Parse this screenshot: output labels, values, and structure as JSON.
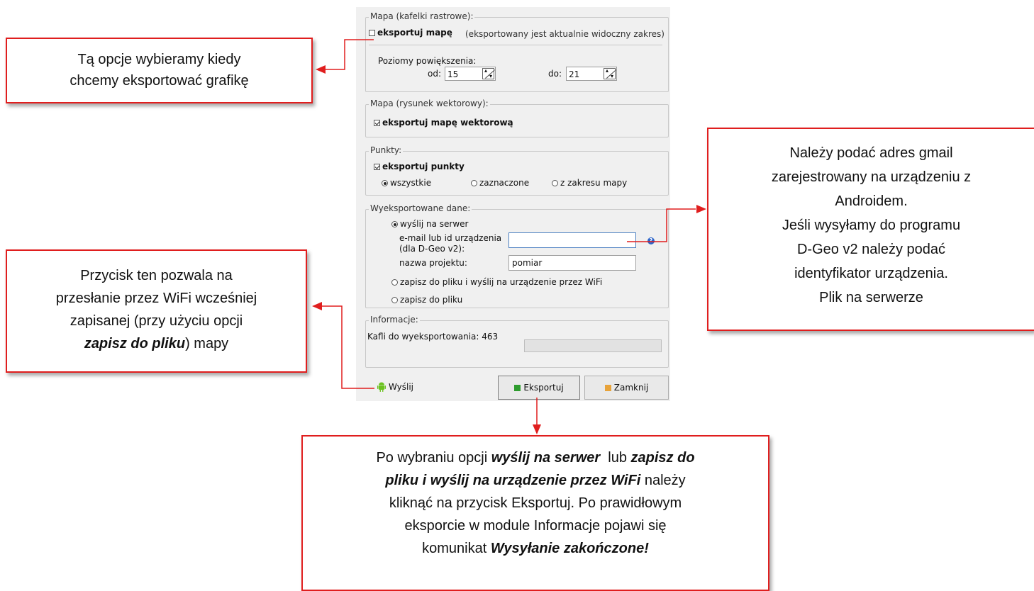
{
  "colors": {
    "dialog_bg": "#f0f0f0",
    "callout_border": "#e01e1e",
    "android_green": "#6bc21f",
    "export_icon_green": "#2e9c2e",
    "close_icon_orange": "#e8a33a",
    "help_icon_blue": "#2b63c9"
  },
  "raster": {
    "title": "Mapa (kafelki rastrowe):",
    "export_checkbox_label": "eksportuj mapę",
    "export_checked": false,
    "export_note": "(eksportowany jest aktualnie widoczny zakres)",
    "zoom_heading": "Poziomy powiększenia:",
    "from_label": "od:",
    "from_value": "15",
    "to_label": "do:",
    "to_value": "21"
  },
  "vector": {
    "title": "Mapa (rysunek wektorowy):",
    "export_label": "eksportuj mapę wektorową",
    "export_checked": true
  },
  "points": {
    "title": "Punkty:",
    "export_label": "eksportuj punkty",
    "export_checked": true,
    "options": [
      {
        "label": "wszystkie",
        "selected": true
      },
      {
        "label": "zaznaczone",
        "selected": false
      },
      {
        "label": "z zakresu mapy",
        "selected": false
      }
    ]
  },
  "exported": {
    "title": "Wyeksportowane dane:",
    "send_server_label": "wyślij na serwer",
    "send_server_selected": true,
    "email_label_line1": "e-mail lub id urządzenia",
    "email_label_line2": "(dla D-Geo v2):",
    "email_value": "",
    "project_label": "nazwa projektu:",
    "project_value": "pomiar",
    "save_and_wifi_label": "zapisz do pliku i wyślij na urządzenie przez WiFi",
    "save_and_wifi_selected": false,
    "save_file_label": "zapisz do pliku",
    "save_file_selected": false,
    "help_icon": "question-icon"
  },
  "info": {
    "title": "Informacje:",
    "tiles_text": "Kafli do wyeksportowania: 463",
    "progress": 0
  },
  "buttons": {
    "send_label": "Wyślij",
    "send_icon": "android-icon",
    "export_label": "Eksportuj",
    "export_icon": "green-square-icon",
    "close_label": "Zamknij",
    "close_icon": "orange-square-icon"
  },
  "callouts": {
    "raster": {
      "line1": "Tą opcje wybieramy kiedy",
      "line2": "chcemy eksportować grafikę"
    },
    "wyslij": {
      "line1": "Przycisk ten pozwala na",
      "line2": "przesłanie przez WiFi  wcześniej",
      "line3": "zapisanej (przy użyciu opcji",
      "line4_em": "zapisz do pliku",
      "line4_rest": ") mapy"
    },
    "email": {
      "line1": "Należy podać adres gmail",
      "line2": "zarejestrowany na urządzeniu z",
      "line3": "Androidem.",
      "line4": "Jeśli wysyłamy do programu",
      "line5": "D-Geo v2 należy podać",
      "line6": "identyfikator urządzenia.",
      "line7": "Plik na serwerze"
    },
    "export": {
      "l1_a": "Po wybraniu opcji ",
      "l1_em1": "wyślij na serwer",
      "l1_b": "  lub ",
      "l1_em2": "zapisz do",
      "l2_em": "pliku i wyślij na urządzenie przez WiFi",
      "l2_b": " należy",
      "l3": "kliknąć na przycisk Eksportuj. Po prawidłowym",
      "l4": "eksporcie w module Informacje pojawi się",
      "l5_a": "komunikat ",
      "l5_em": "Wysyłanie zakończone!"
    }
  }
}
